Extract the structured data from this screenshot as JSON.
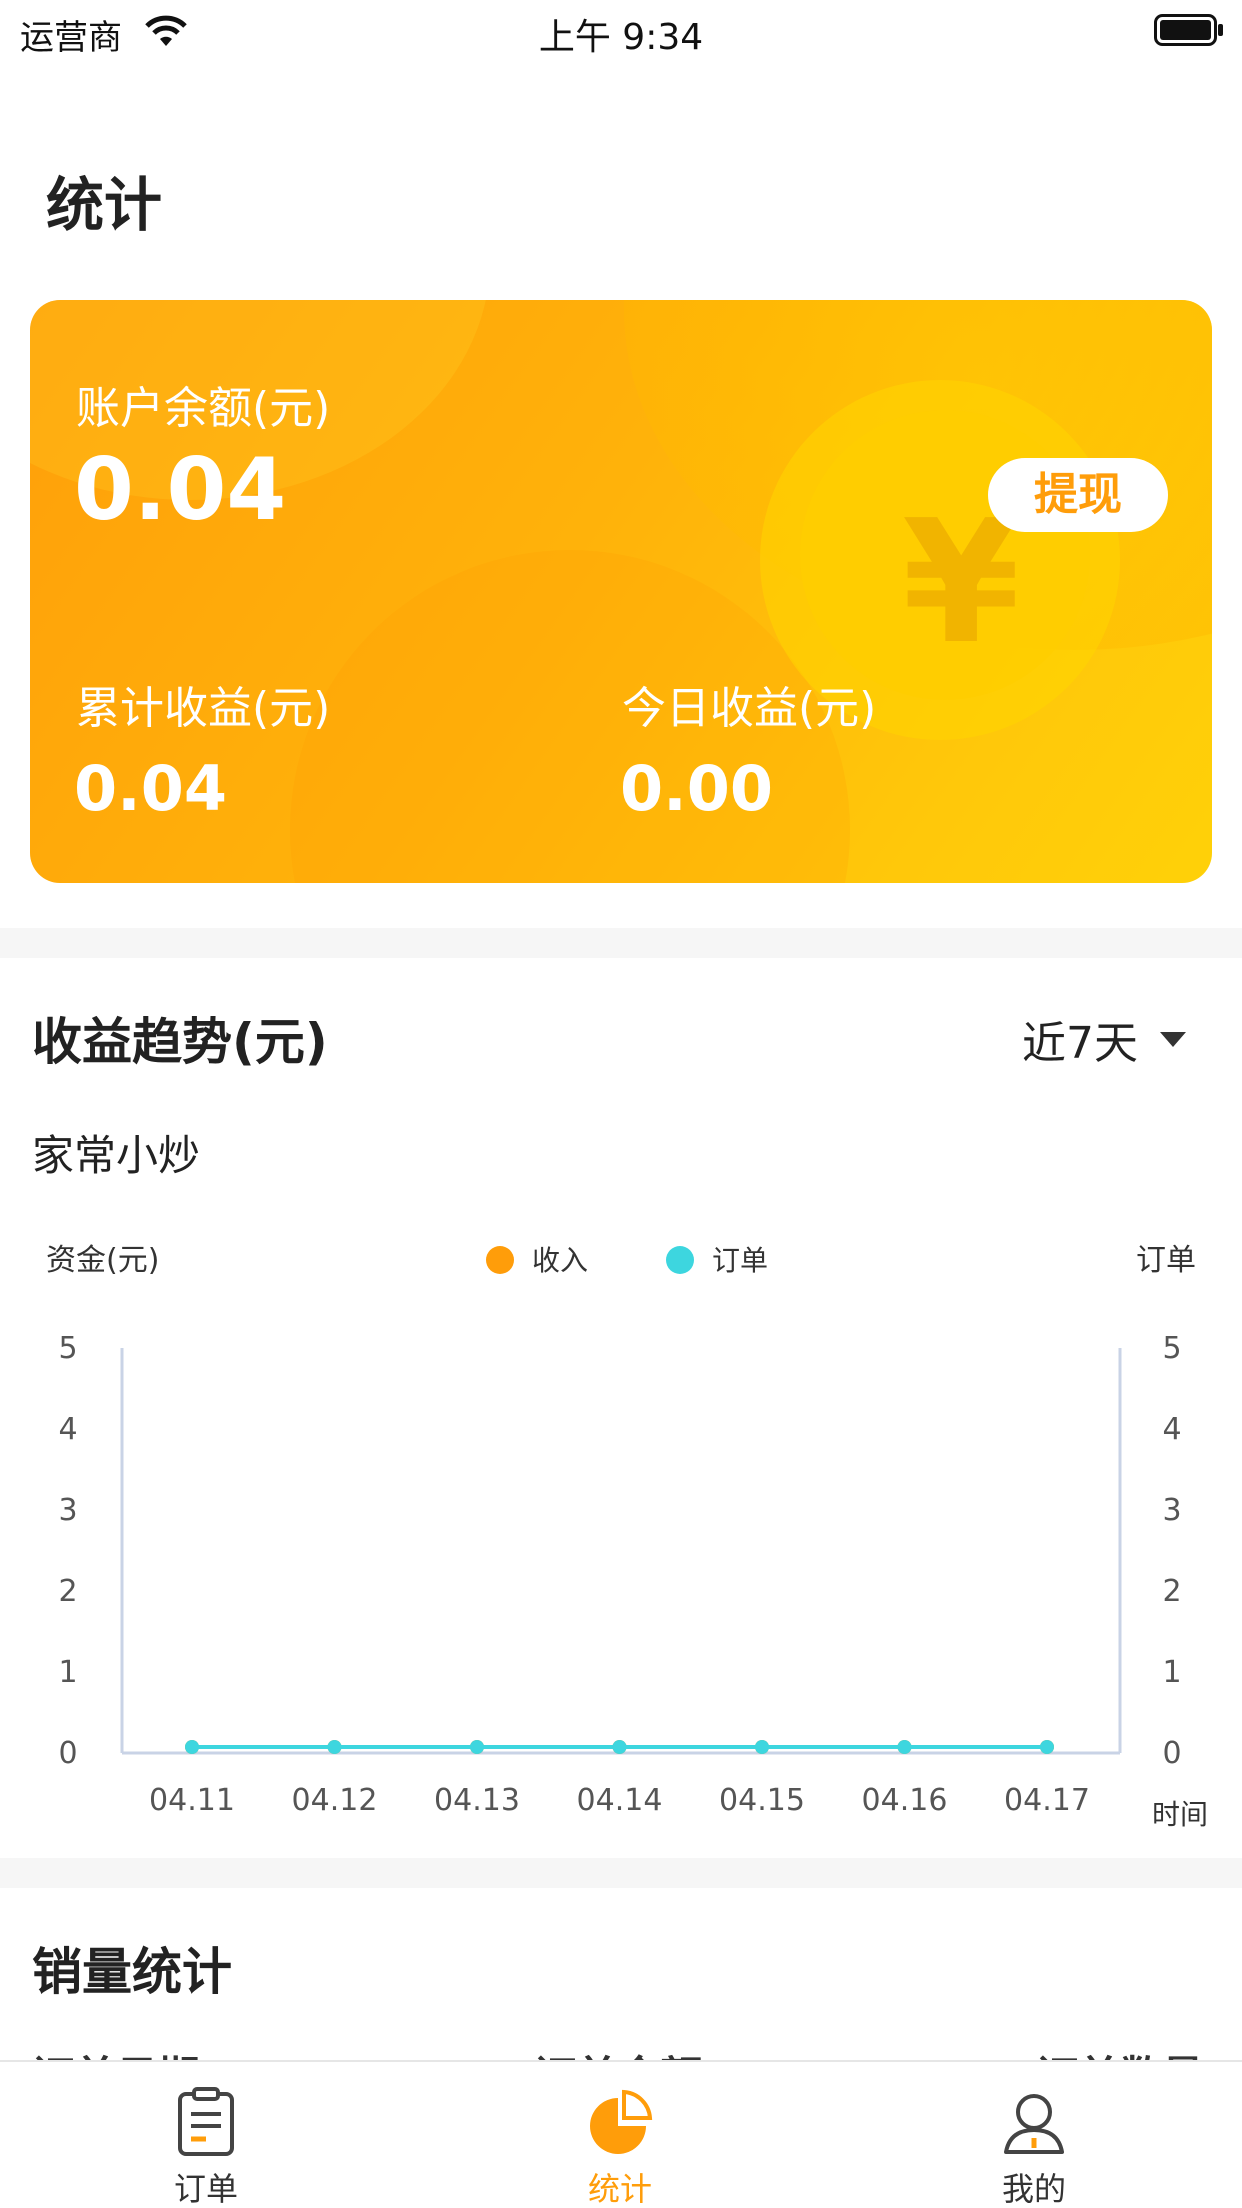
{
  "status_bar": {
    "carrier": "运营商",
    "time": "上午 9:34"
  },
  "page_title": "统计",
  "card": {
    "balance_label": "账户余额(元)",
    "balance_value": "0.04",
    "withdraw_label": "提现",
    "total_label": "累计收益(元)",
    "total_value": "0.04",
    "today_label": "今日收益(元)",
    "today_value": "0.00",
    "accent": "#ff9d0a"
  },
  "trend": {
    "title": "收益趋势(元)",
    "range": "近7天",
    "shop_name": "家常小炒"
  },
  "chart_data": {
    "type": "line",
    "y_left_label": "资金(元)",
    "y_right_label": "订单",
    "x_label": "时间",
    "categories": [
      "04.11",
      "04.12",
      "04.13",
      "04.14",
      "04.15",
      "04.16",
      "04.17"
    ],
    "yticks": [
      0,
      1,
      2,
      3,
      4,
      5
    ],
    "ylim": [
      0,
      5
    ],
    "legend_placement": "top-center",
    "series": [
      {
        "name": "收入",
        "color": "#ff9d0a",
        "values": [
          0,
          0,
          0,
          0,
          0,
          0,
          0
        ]
      },
      {
        "name": "订单",
        "color": "#3dd6df",
        "values": [
          0,
          0,
          0,
          0,
          0,
          0,
          0
        ]
      }
    ]
  },
  "sales": {
    "title": "销量统计",
    "columns": [
      "订单日期",
      "订单金额",
      "订单数量"
    ]
  },
  "tab_bar": {
    "items": [
      {
        "label": "订单",
        "icon": "clipboard-icon"
      },
      {
        "label": "统计",
        "icon": "pie-chart-icon"
      },
      {
        "label": "我的",
        "icon": "person-icon"
      }
    ],
    "active_color": "#ff9d0a"
  }
}
